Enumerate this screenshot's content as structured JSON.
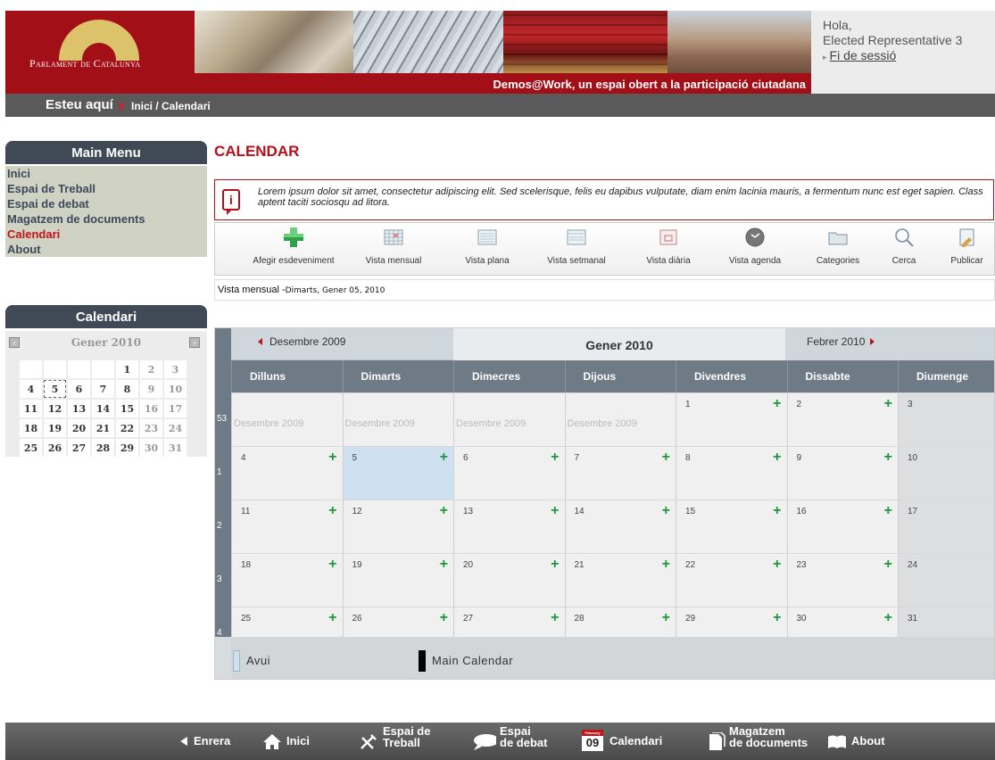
{
  "header": {
    "logo_text": "Parlament de Catalunya",
    "tagline": "Demos@Work, un espai obert a la participació ciutadana",
    "greeting": "Hola,",
    "user": "Elected Representative 3",
    "logout": "Fi de sessió"
  },
  "breadcrumb": {
    "here": "Esteu aquí",
    "path": "Inici / Calendari"
  },
  "sidebar": {
    "menu_title": "Main Menu",
    "items": [
      {
        "label": "Inici"
      },
      {
        "label": "Espai de Treball"
      },
      {
        "label": "Espai de debat"
      },
      {
        "label": "Magatzem de documents"
      },
      {
        "label": "Calendari"
      },
      {
        "label": "About"
      }
    ],
    "calendar_title": "Calendari",
    "mini_month": "Gener 2010",
    "mini_weeks": [
      [
        "",
        "",
        "",
        "",
        "1",
        "2",
        "3"
      ],
      [
        "4",
        "5",
        "6",
        "7",
        "8",
        "9",
        "10"
      ],
      [
        "11",
        "12",
        "13",
        "14",
        "15",
        "16",
        "17"
      ],
      [
        "18",
        "19",
        "20",
        "21",
        "22",
        "23",
        "24"
      ],
      [
        "25",
        "26",
        "27",
        "28",
        "29",
        "30",
        "31"
      ]
    ]
  },
  "main": {
    "title": "CALENDAR",
    "info_text": "Lorem ipsum dolor sit amet, consectetur adipiscing elit. Sed scelerisque, felis eu dapibus vulputate, diam enim lacinia mauris, a fermentum nunc est eget sapien. Class aptent taciti sociosqu ad litora.",
    "toolbar": [
      {
        "label": "Afegir esdeveniment",
        "icon": "add-event-icon"
      },
      {
        "label": "Vista mensual",
        "icon": "month-view-icon"
      },
      {
        "label": "Vista plana",
        "icon": "flat-view-icon"
      },
      {
        "label": "Vista setmanal",
        "icon": "week-view-icon"
      },
      {
        "label": "Vista diària",
        "icon": "day-view-icon"
      },
      {
        "label": "Vista agenda",
        "icon": "agenda-view-icon"
      },
      {
        "label": "Categories",
        "icon": "folder-icon"
      },
      {
        "label": "Cerca",
        "icon": "search-icon"
      },
      {
        "label": "Publicar",
        "icon": "publish-icon"
      }
    ],
    "view_label": "Vista mensual -",
    "view_sub": "Dimarts, Gener 05, 2010",
    "prev_month": "Desembre 2009",
    "current_month": "Gener 2010",
    "next_month": "Febrer 2010",
    "days": [
      "Dilluns",
      "Dimarts",
      "Dimecres",
      "Dijous",
      "Divendres",
      "Dissabte",
      "Diumenge"
    ],
    "weeks": [
      {
        "num": "53",
        "cells": [
          "Desembre 2009",
          "Desembre 2009",
          "Desembre 2009",
          "Desembre 2009",
          "1",
          "2",
          "3"
        ]
      },
      {
        "num": "1",
        "cells": [
          "4",
          "5",
          "6",
          "7",
          "8",
          "9",
          "10"
        ]
      },
      {
        "num": "2",
        "cells": [
          "11",
          "12",
          "13",
          "14",
          "15",
          "16",
          "17"
        ]
      },
      {
        "num": "3",
        "cells": [
          "18",
          "19",
          "20",
          "21",
          "22",
          "23",
          "24"
        ]
      },
      {
        "num": "4",
        "cells": [
          "25",
          "26",
          "27",
          "28",
          "29",
          "30",
          "31"
        ]
      }
    ],
    "legend_today": "Avui",
    "legend_main": "Main Calendar"
  },
  "footer": {
    "back": "Enrera",
    "home": "Inici",
    "work_1": "Espai de",
    "work_2": "Treball",
    "debate_1": "Espai",
    "debate_2": "de debat",
    "calendar": "Calendari",
    "calendar_icon_month": "February",
    "calendar_icon_day": "09",
    "docs_1": "Magatzem",
    "docs_2": "de documents",
    "about": "About"
  }
}
